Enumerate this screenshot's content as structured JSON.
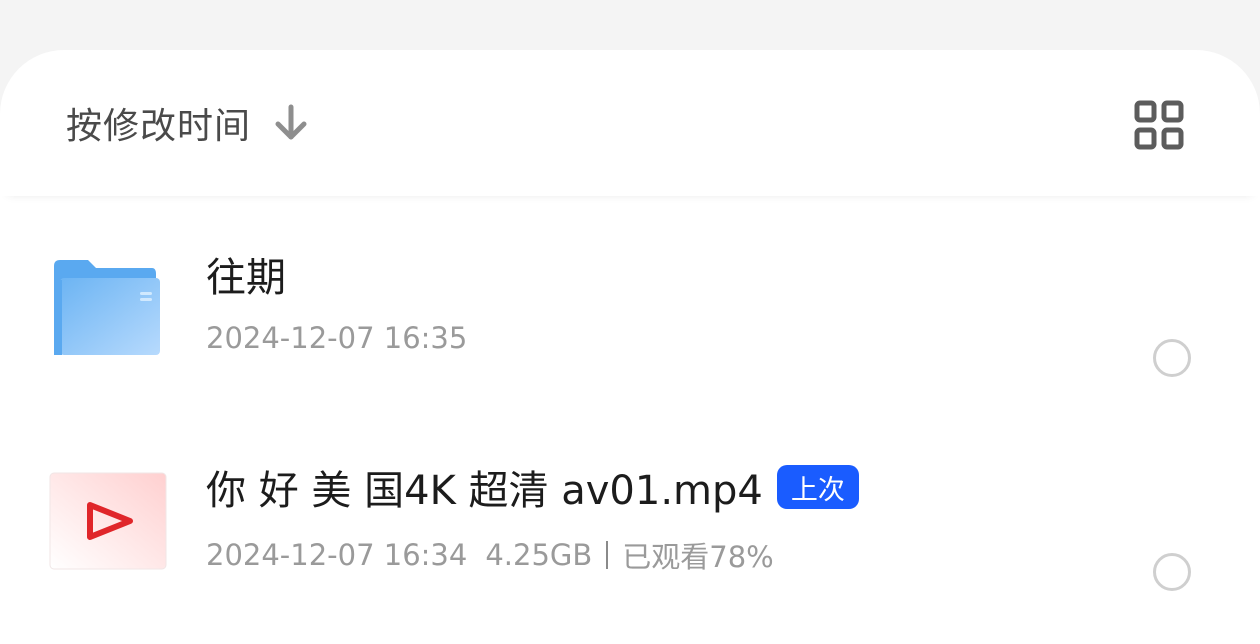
{
  "sort": {
    "label": "按修改时间",
    "direction_icon": "arrow-down-icon"
  },
  "view_toggle": {
    "icon": "grid-view-icon"
  },
  "colors": {
    "folder": "#5aa9f0",
    "badge": "#1a5cff",
    "video_play": "#e0262a"
  },
  "files": [
    {
      "type": "folder",
      "name": "往期",
      "modified": "2024-12-07 16:35",
      "icon": "folder-icon",
      "selected": false
    },
    {
      "type": "video",
      "name": "你 好 美 国4K 超清  av01.mp4",
      "badge": "上次",
      "modified": "2024-12-07 16:34",
      "size": "4.25GB",
      "progress_text": "已观看78%",
      "watched_fraction": 0.78,
      "icon": "video-thumbnail-icon",
      "selected": false
    }
  ]
}
